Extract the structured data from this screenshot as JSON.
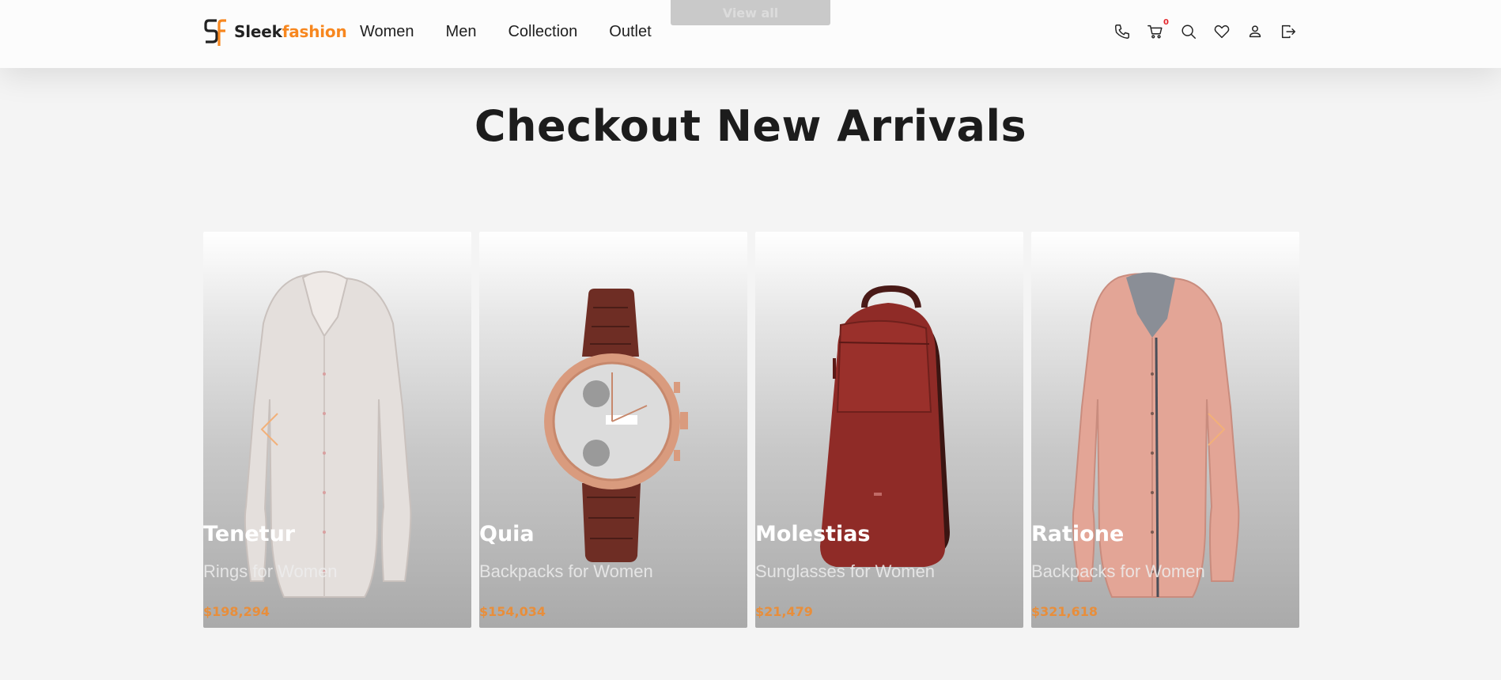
{
  "header": {
    "ghost_button": "View all",
    "logo": {
      "part1": "Sleek",
      "part2": "fashion"
    },
    "nav": [
      "Women",
      "Men",
      "Collection",
      "Outlet"
    ],
    "icons": [
      "phone-icon",
      "cart-icon",
      "search-icon",
      "heart-icon",
      "user-icon",
      "logout-icon"
    ],
    "cart_count": "0"
  },
  "main": {
    "title": "Checkout New Arrivals",
    "products": [
      {
        "name": "Tenetur",
        "category": "Rings for Women",
        "price": "$198,294",
        "image": "white-shirt"
      },
      {
        "name": "Quia",
        "category": "Backpacks for Women",
        "price": "$154,034",
        "image": "rose-gold-watch"
      },
      {
        "name": "Molestias",
        "category": "Sunglasses for Women",
        "price": "$21,479",
        "image": "red-backpack"
      },
      {
        "name": "Ratione",
        "category": "Backpacks for Women",
        "price": "$321,618",
        "image": "pink-shirt"
      }
    ],
    "prev_icon": "chevron-left-icon",
    "next_icon": "chevron-right-icon"
  },
  "colors": {
    "brand": "#f7871f",
    "text": "#1c1c1c",
    "background": "#f4f4f4",
    "badge": "#e3262b"
  }
}
